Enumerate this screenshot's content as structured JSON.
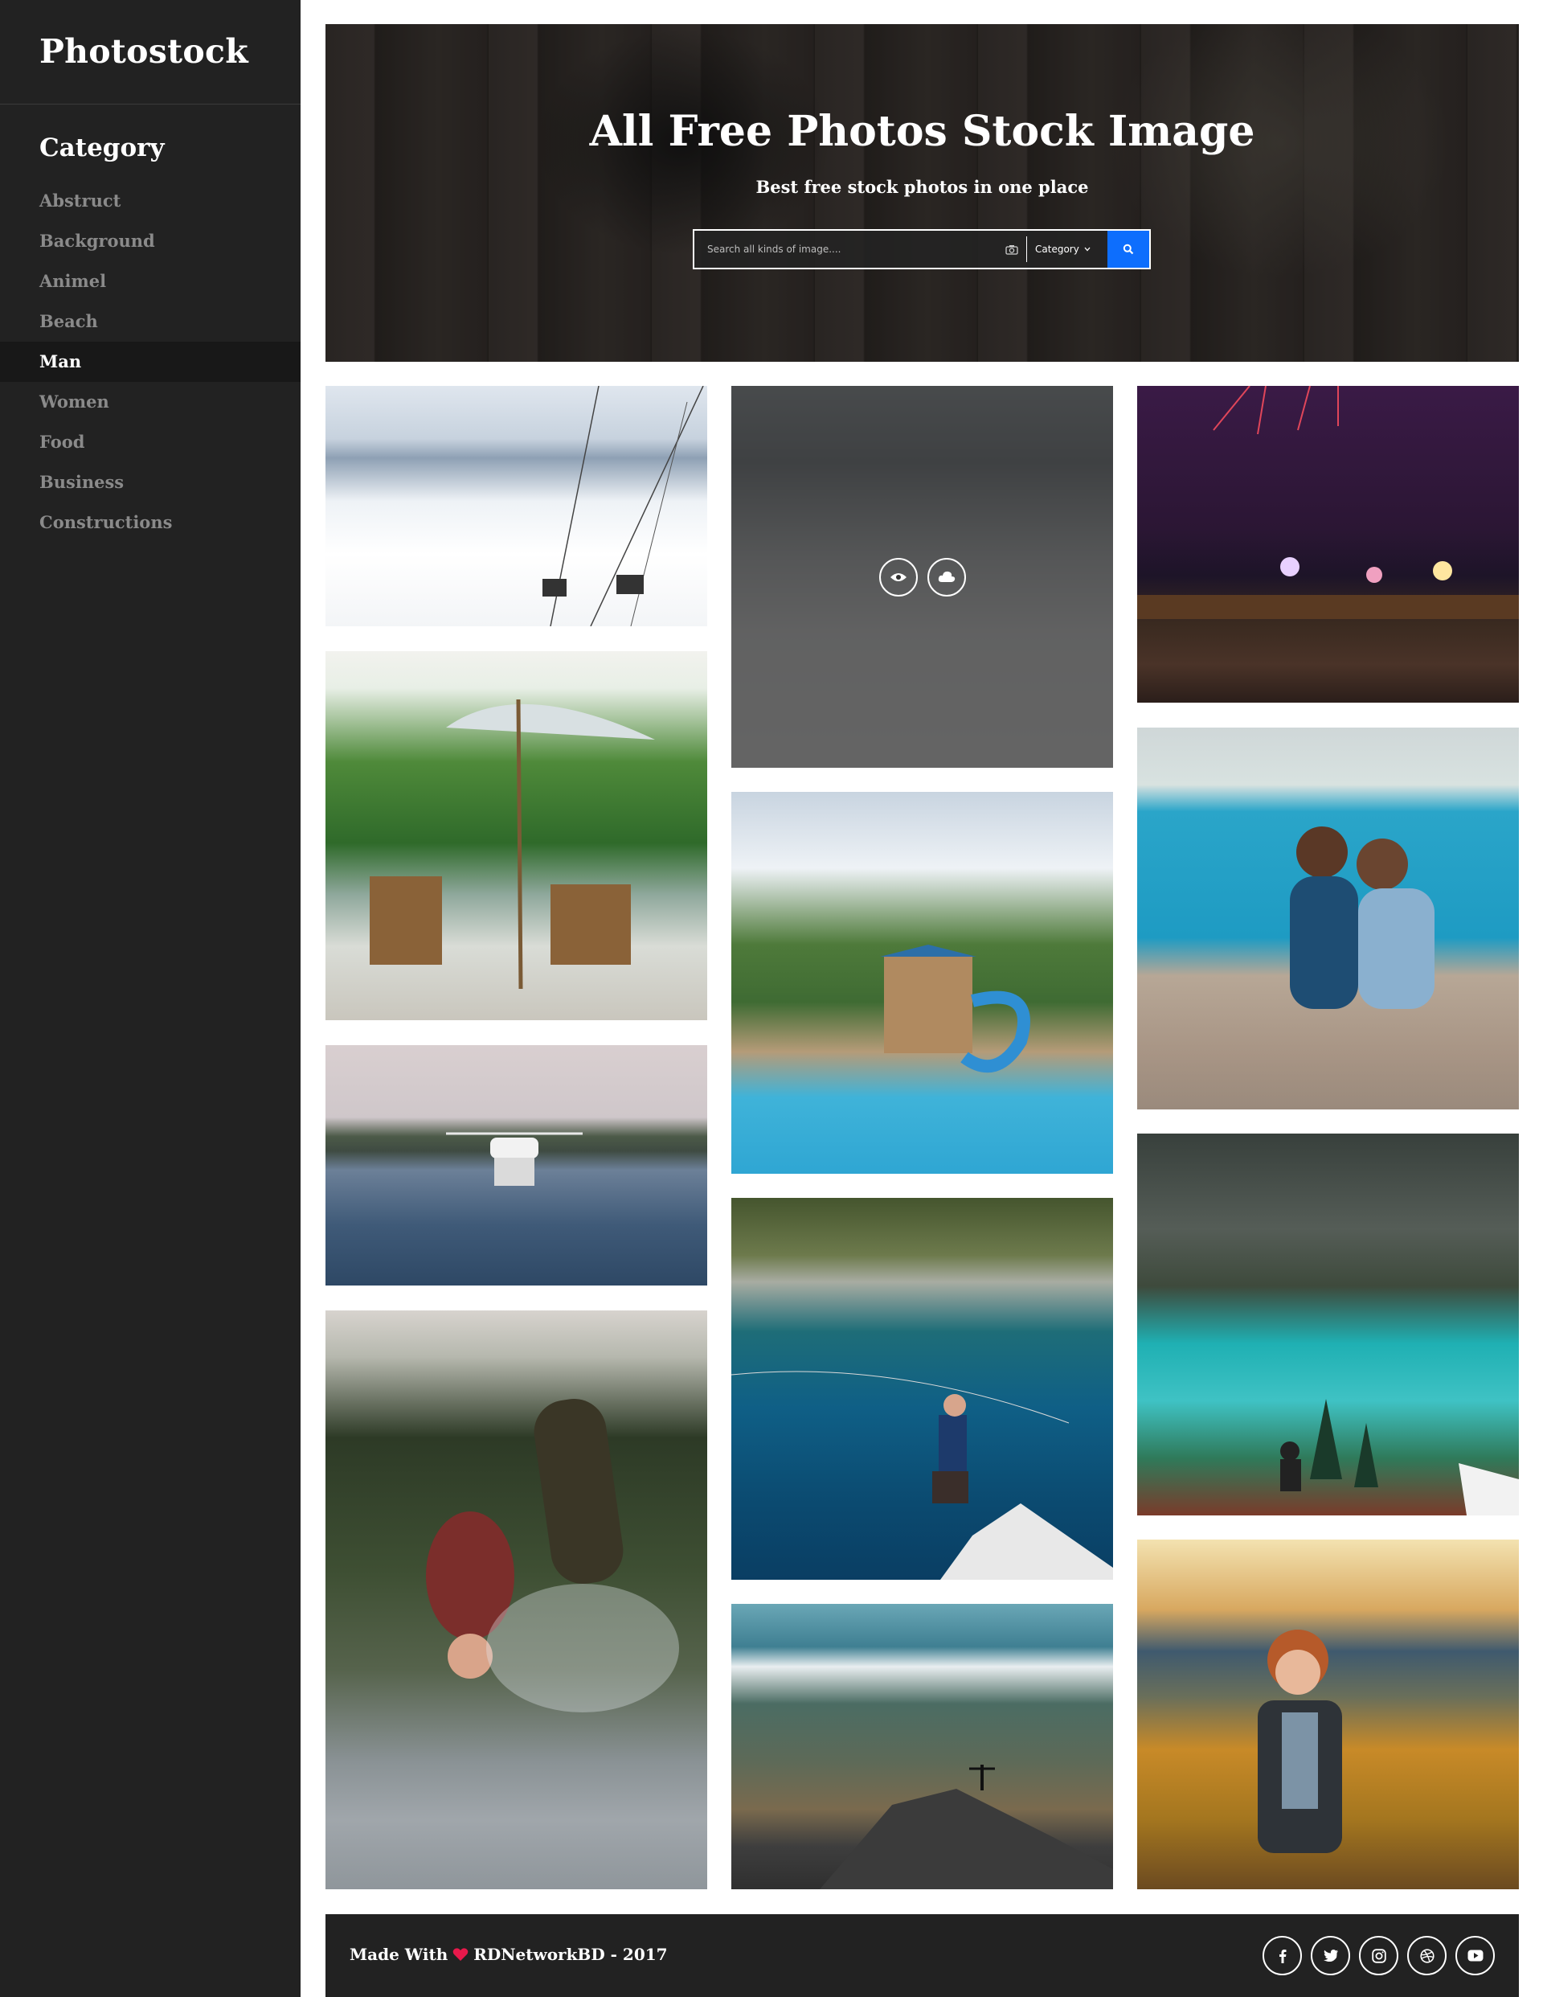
{
  "sidebar": {
    "logo": "Photostock",
    "category_title": "Category",
    "items": [
      {
        "label": "Abstruct"
      },
      {
        "label": "Background"
      },
      {
        "label": "Animel"
      },
      {
        "label": "Beach"
      },
      {
        "label": "Man",
        "active": true
      },
      {
        "label": "Women"
      },
      {
        "label": "Food"
      },
      {
        "label": "Business"
      },
      {
        "label": "Constructions"
      }
    ]
  },
  "hero": {
    "title": "All Free Photos Stock Image",
    "subtitle": "Best free stock photos in one place",
    "search_placeholder": "Search all kinds of image....",
    "category_label": "Category",
    "camera_icon": "camera-icon",
    "search_icon": "search-icon",
    "search_button_color": "#0d6efd"
  },
  "gallery": {
    "photos": [
      {
        "name": "snowy-mountains-ski-lift",
        "column": 1
      },
      {
        "name": "beach-umbrellas-lounge-chairs",
        "column": 1
      },
      {
        "name": "drone-over-lake",
        "column": 1
      },
      {
        "name": "wakeboarder-flip",
        "column": 1
      },
      {
        "name": "skier-mountain",
        "column": 2,
        "hovered": true
      },
      {
        "name": "water-park-pool",
        "column": 2
      },
      {
        "name": "fly-fishing-lake",
        "column": 2
      },
      {
        "name": "hiker-mountain-valley",
        "column": 2
      },
      {
        "name": "fireworks-city-night",
        "column": 3
      },
      {
        "name": "couple-on-rocks-sea",
        "column": 3
      },
      {
        "name": "turquoise-mountain-lake",
        "column": 3
      },
      {
        "name": "woman-blowing-dandelion",
        "column": 3
      }
    ],
    "overlay_icons": [
      "eye-icon",
      "cloud-download-icon"
    ]
  },
  "footer": {
    "made_with": "Made With",
    "heart_icon": "heart-icon",
    "heart_color": "#e8194b",
    "credit": "RDNetworkBD - 2017",
    "social": [
      "facebook-icon",
      "twitter-icon",
      "instagram-icon",
      "dribbble-icon",
      "youtube-icon"
    ]
  }
}
